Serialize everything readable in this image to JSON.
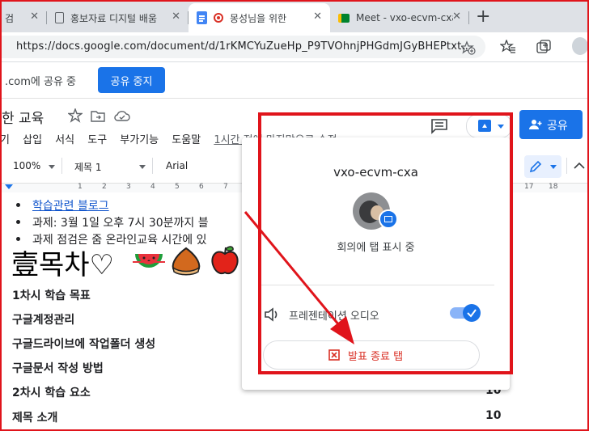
{
  "tabs": [
    {
      "label": "검",
      "close": "✕"
    },
    {
      "label": "홍보자료 디지털 배움",
      "close": "✕"
    },
    {
      "label": "몽성님을 위한",
      "close": "✕"
    },
    {
      "label": "Meet - vxo-ecvm-cxa",
      "close": "✕"
    }
  ],
  "new_tab": "+",
  "address": {
    "url": "https://docs.google.com/document/d/1rKMCYuZueHp_P9TVOhnjPHGdmJGyBHEPtxt..."
  },
  "sharebar": {
    "text": ".com에 공유 중",
    "stop_button": "공유 중지"
  },
  "doc": {
    "title": "한 교육",
    "menu": [
      "기",
      "삽입",
      "서식",
      "도구",
      "부가기능",
      "도움말"
    ],
    "last_edit": "1시간 전에 마지막으로 수정",
    "share_button": "공유",
    "toolbar": {
      "zoom": "100%",
      "style": "제목 1",
      "font": "Arial"
    },
    "ruler": {
      "left_marks": [
        "1",
        "2",
        "3",
        "4",
        "5",
        "6",
        "7"
      ],
      "right_marks": [
        "17",
        "18"
      ]
    },
    "content": {
      "link": "학습관련 블로그",
      "bullet2": "과제: 3월 1일 오후 7시 30분까지 블",
      "bullet3": "과제 점검은 줌 온라인교육 시간에 있",
      "heading": "壹목차♡",
      "lines": [
        {
          "text": "1차시 학습 목표",
          "num": ""
        },
        {
          "text": "구글계정관리",
          "num": ""
        },
        {
          "text": "구글드라이브에 작업폴더 생성",
          "num": ""
        },
        {
          "text": "구글문서 작성 방법",
          "num": ""
        },
        {
          "text": "2차시 학습 요소",
          "num": "10"
        },
        {
          "text": "제목 소개",
          "num": "10"
        }
      ]
    }
  },
  "popup": {
    "meeting_code": "vxo-ecvm-cxa",
    "status": "회의에 탭 표시 중",
    "audio_label": "프레젠테이션 오디오",
    "stop_button": "발표 종료 탭"
  },
  "colors": {
    "accent": "#1a73e8",
    "annotation_red": "#e0141b"
  }
}
